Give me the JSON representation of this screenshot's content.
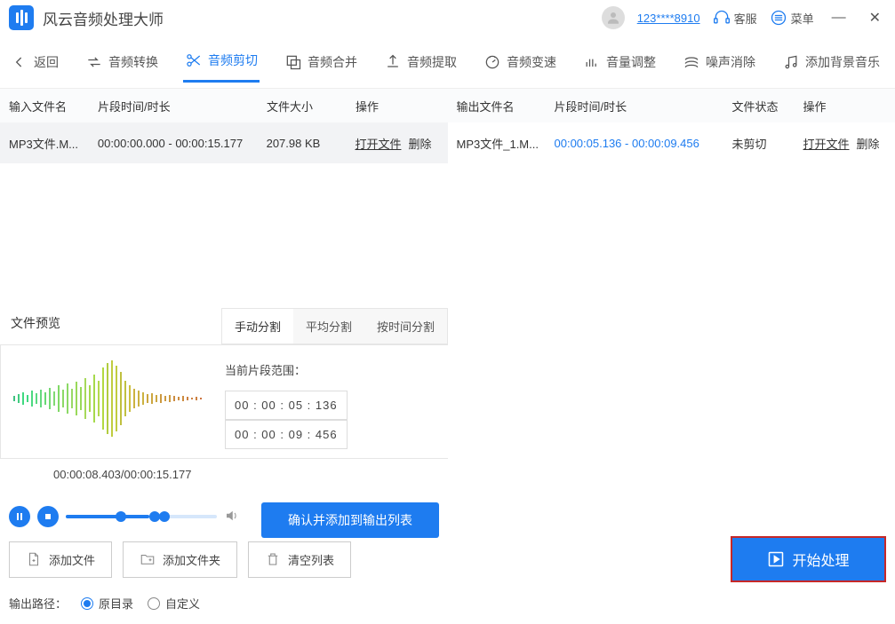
{
  "app": {
    "title": "风云音频处理大师",
    "user": "123****8910",
    "support": "客服",
    "menu": "菜单"
  },
  "toolbar": {
    "back": "返回",
    "items": [
      "音频转换",
      "音频剪切",
      "音频合并",
      "音频提取",
      "音频变速",
      "音量调整",
      "噪声消除",
      "添加背景音乐"
    ],
    "active": 1
  },
  "left": {
    "headers": [
      "输入文件名",
      "片段时间/时长",
      "文件大小",
      "操作"
    ],
    "row": {
      "name": "MP3文件.M...",
      "time": "00:00:00.000 - 00:00:15.177",
      "size": "207.98 KB"
    },
    "open": "打开文件",
    "del": "删除"
  },
  "right": {
    "headers": [
      "输出文件名",
      "片段时间/时长",
      "文件状态",
      "操作"
    ],
    "row": {
      "name": "MP3文件_1.M...",
      "time": "00:00:05.136 - 00:00:09.456",
      "status": "未剪切"
    },
    "open": "打开文件",
    "del": "删除"
  },
  "preview": {
    "title": "文件预览",
    "tabs": [
      "手动分割",
      "平均分割",
      "按时间分割"
    ],
    "range_label": "当前片段范围：",
    "start": "00 : 00 : 05 : 136",
    "end": "00 : 00 : 09 : 456",
    "time": "00:00:08.403/00:00:15.177",
    "confirm": "确认并添加到输出列表"
  },
  "bottom": {
    "add_file": "添加文件",
    "add_folder": "添加文件夹",
    "clear": "清空列表",
    "start": "开始处理",
    "out_label": "输出路径：",
    "opt1": "原目录",
    "opt2": "自定义"
  }
}
